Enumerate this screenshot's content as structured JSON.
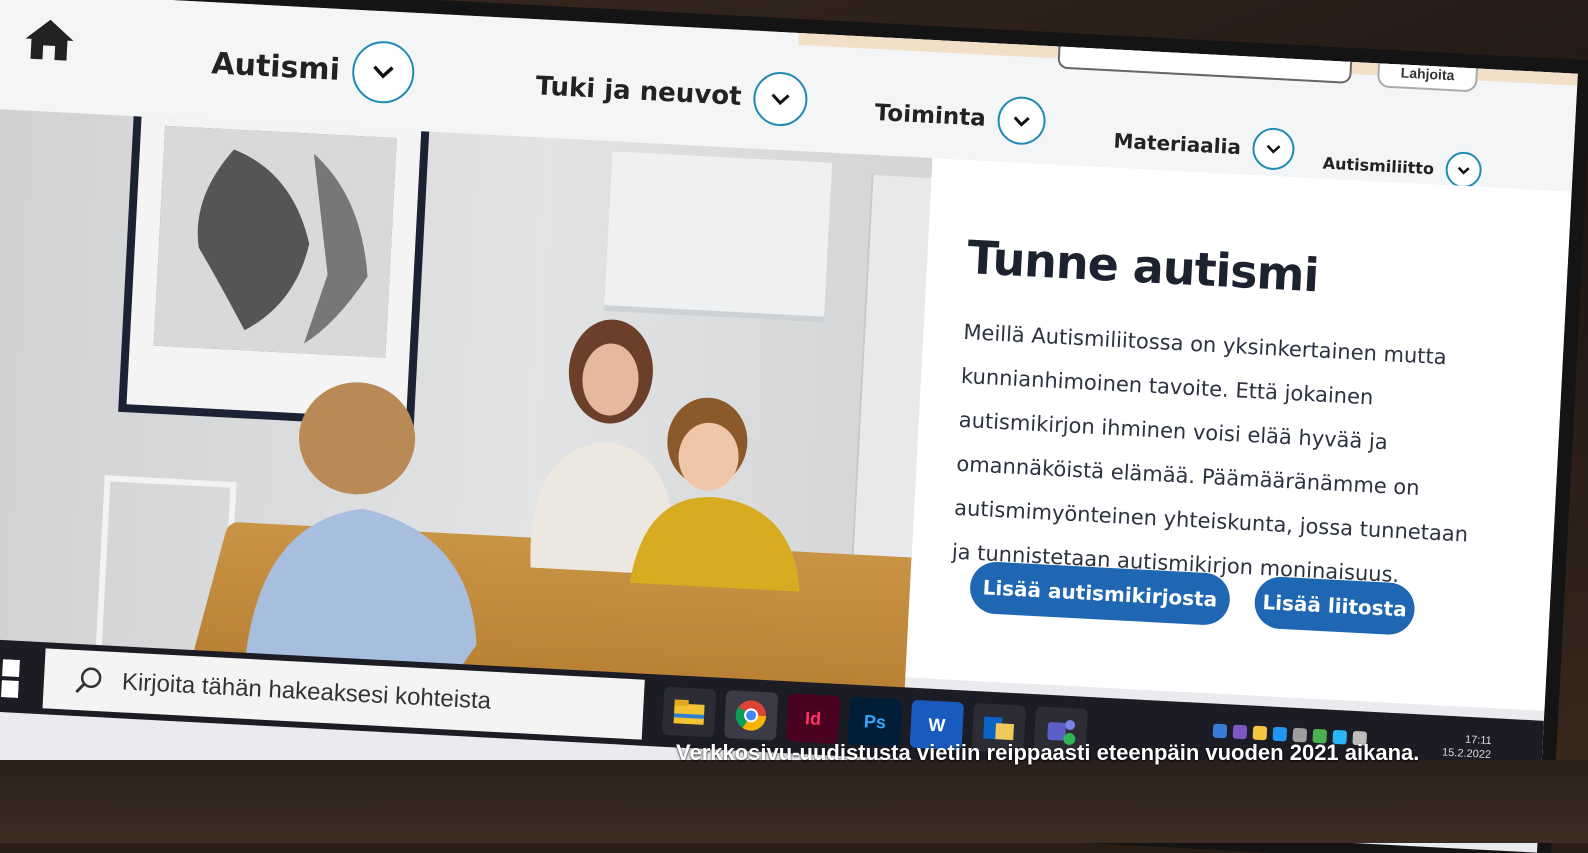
{
  "colors": {
    "accent_blue": "#1f66b3",
    "chevron_ring": "#1f8bb0",
    "topbar_peach": "#f2dfc8"
  },
  "header": {
    "donate_label": "Lahjoita",
    "nav": [
      {
        "label": "Autismi",
        "icon": "chevron-down-icon"
      },
      {
        "label": "Tuki ja neuvot",
        "icon": "chevron-down-icon"
      },
      {
        "label": "Toiminta",
        "icon": "chevron-down-icon"
      },
      {
        "label": "Materiaalia",
        "icon": "chevron-down-icon"
      },
      {
        "label": "Autismiliitto",
        "icon": "chevron-down-icon"
      }
    ]
  },
  "hero": {
    "title": "Tunne autismi",
    "body": "Meillä Autismiliitossa on yksinkertainen mutta kunnianhimoinen tavoite. Että jokainen autismikirjon ihminen voisi elää hyvää ja omannäköistä elämää. Päämääränämme on autismimyönteinen yhteiskunta, jossa tunnetaan ja tunnistetaan autismikirjon moninaisuus.",
    "button_primary": "Lisää autismikirjosta",
    "button_secondary": "Lisää liitosta"
  },
  "taskbar": {
    "search_placeholder": "Kirjoita tähän hakeaksesi kohteista",
    "apps": [
      "file-explorer-icon",
      "chrome-icon",
      "indesign-icon",
      "photoshop-icon",
      "word-icon",
      "outlook-icon",
      "teams-icon"
    ],
    "app_labels": {
      "indesign": "Id",
      "photoshop": "Ps",
      "word": "W"
    },
    "clock_time": "17:11",
    "clock_date": "15.2.2022"
  },
  "caption": "Verkkosivu-uudistusta vietiin reippaasti eteenpäin vuoden 2021 aikana."
}
